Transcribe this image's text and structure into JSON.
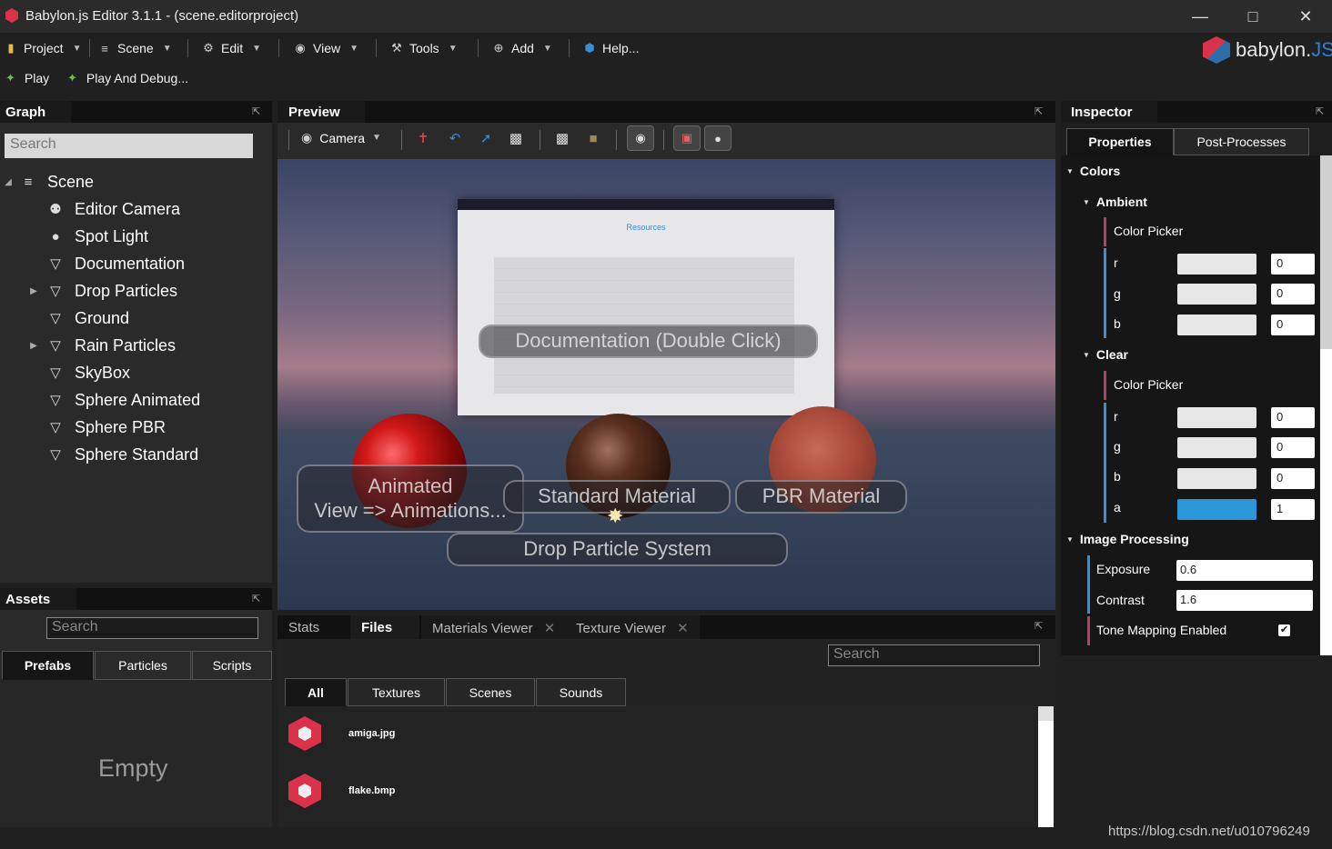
{
  "window": {
    "title": "Babylon.js Editor 3.1.1 - (scene.editorproject)"
  },
  "menu": {
    "project": "Project",
    "scene": "Scene",
    "edit": "Edit",
    "view": "View",
    "tools": "Tools",
    "add": "Add",
    "help": "Help..."
  },
  "run": {
    "play": "Play",
    "play_debug": "Play And Debug..."
  },
  "brand": {
    "name": "babylon.",
    "suffix": "JS"
  },
  "graph": {
    "tab": "Graph",
    "search_placeholder": "Search",
    "root": "Scene",
    "nodes": [
      {
        "label": "Editor Camera",
        "icon": "camera-icon",
        "expandable": false
      },
      {
        "label": "Spot Light",
        "icon": "bulb-icon",
        "expandable": false
      },
      {
        "label": "Documentation",
        "icon": "mesh-icon",
        "expandable": false
      },
      {
        "label": "Drop Particles",
        "icon": "mesh-icon",
        "expandable": true
      },
      {
        "label": "Ground",
        "icon": "mesh-icon",
        "expandable": false
      },
      {
        "label": "Rain Particles",
        "icon": "mesh-icon",
        "expandable": true
      },
      {
        "label": "SkyBox",
        "icon": "mesh-icon",
        "expandable": false
      },
      {
        "label": "Sphere Animated",
        "icon": "mesh-icon",
        "expandable": false
      },
      {
        "label": "Sphere PBR",
        "icon": "mesh-icon",
        "expandable": false
      },
      {
        "label": "Sphere Standard",
        "icon": "mesh-icon",
        "expandable": false
      }
    ]
  },
  "assets": {
    "tab": "Assets",
    "search_placeholder": "Search",
    "tabs": [
      "Prefabs",
      "Particles",
      "Scripts"
    ],
    "empty": "Empty"
  },
  "preview": {
    "tab": "Preview",
    "camera_label": "Camera",
    "labels": {
      "doc": "Documentation (Double Click)",
      "animated_1": "Animated",
      "animated_2": "View => Animations...",
      "standard": "Standard Material",
      "pbr": "PBR Material",
      "drop": "Drop Particle System"
    },
    "doc_heading": "Resources"
  },
  "files": {
    "tabs": [
      "Stats",
      "Files",
      "Materials Viewer",
      "Texture Viewer"
    ],
    "search_placeholder": "Search",
    "filters": [
      "All",
      "Textures",
      "Scenes",
      "Sounds"
    ],
    "items": [
      "amiga.jpg",
      "flake.bmp"
    ]
  },
  "inspector": {
    "tab": "Inspector",
    "tabs": [
      "Properties",
      "Post-Processes"
    ],
    "colors": "Colors",
    "ambient": "Ambient",
    "clear": "Clear",
    "color_picker": "Color Picker",
    "r": "r",
    "g": "g",
    "b": "b",
    "a": "a",
    "ambient_values": {
      "r": "0",
      "g": "0",
      "b": "0"
    },
    "clear_values": {
      "r": "0",
      "g": "0",
      "b": "0",
      "a": "1"
    },
    "image_processing": "Image Processing",
    "exposure_label": "Exposure",
    "exposure": "0.6",
    "contrast_label": "Contrast",
    "contrast": "1.6",
    "tone_mapping_label": "Tone Mapping Enabled",
    "tone_mapping_enabled": true,
    "clear_alpha_color": "#2b97d8"
  },
  "watermark": "https://blog.csdn.net/u010796249"
}
